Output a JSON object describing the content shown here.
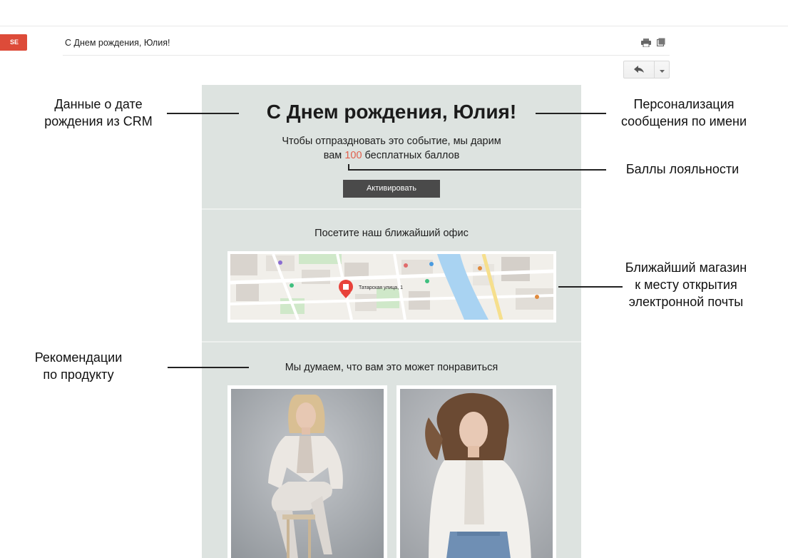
{
  "mail": {
    "button_label": "SE",
    "subject": "С Днем рождения, Юлия!",
    "icons": {
      "print": "print-icon",
      "new_window": "new-window-icon",
      "reply": "reply-icon",
      "more": "chevron-down-icon"
    }
  },
  "email": {
    "headline": "С Днем рождения, Юлия!",
    "lead_line1": "Чтобы отпраздновать это событие, мы дарим",
    "lead_before": "вам ",
    "lead_points": "100",
    "lead_after": " бесплатных баллов",
    "activate_label": "Активировать",
    "office_title": "Посетите наш ближайший офис",
    "map": {
      "address": "Татарская улица, 1",
      "marker_icon": "store-pin-icon"
    },
    "recommendations_title": "Мы думаем, что вам это может понравиться",
    "products": [
      {
        "image": "woman-sitting-on-stool-photo"
      },
      {
        "image": "woman-white-blazer-photo"
      }
    ]
  },
  "annotations": {
    "birthday_data": [
      "Данные о дате",
      "рождения из CRM"
    ],
    "personalization": [
      "Персонализация",
      "сообщения по имени"
    ],
    "loyalty": "Баллы лояльности",
    "nearest_store": [
      "Ближайший магазин",
      "к месту открытия",
      "электронной почты"
    ],
    "recommendations": [
      "Рекомендации",
      "по продукту"
    ]
  },
  "colors": {
    "accent": "#e1604d",
    "email_bg": "#dde3e0",
    "button": "#4a4a4a",
    "gmail_red": "#dd4b39"
  }
}
